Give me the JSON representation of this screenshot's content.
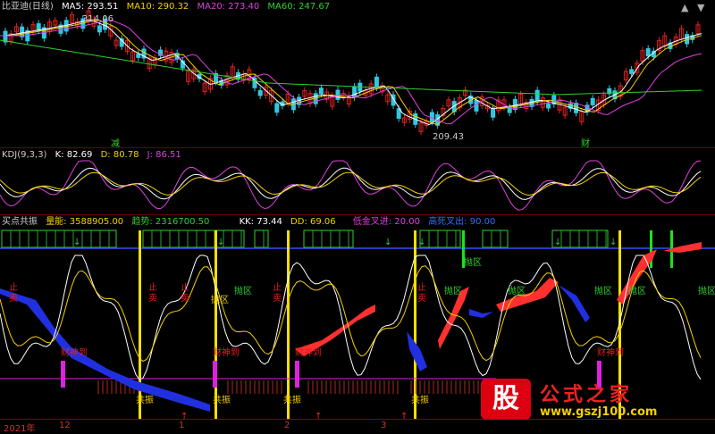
{
  "main": {
    "title": "比亚迪(日线)",
    "ma": [
      {
        "label": "MA5: 293.51",
        "color": "#ffffff"
      },
      {
        "label": "MA10: 290.32",
        "color": "#f5d000"
      },
      {
        "label": "MA20: 273.40",
        "color": "#e040e0"
      },
      {
        "label": "MA60: 247.67",
        "color": "#30d030"
      }
    ],
    "high_label": "314.06",
    "low_label": "209.43",
    "marker_left": "减",
    "marker_right": "财"
  },
  "kdj": {
    "title": "KDJ(9,3,3)",
    "items": [
      {
        "label": "K: 82.69",
        "color": "#ffffff"
      },
      {
        "label": "D: 80.78",
        "color": "#f5d000"
      },
      {
        "label": "J: 86.51",
        "color": "#e040e0"
      }
    ]
  },
  "signal": {
    "title": "买点共振",
    "items": [
      {
        "label": "量能: 3588905.00",
        "color": "#f5d000"
      },
      {
        "label": "趋势: 2316700.50",
        "color": "#30d030"
      },
      {
        "label": "KK: 73.44",
        "color": "#ffffff"
      },
      {
        "label": "DD: 69.06",
        "color": "#f5d000"
      },
      {
        "label": "低金叉进: 20.00",
        "color": "#e040e0"
      },
      {
        "label": "高死叉出: 90.00",
        "color": "#3070ff"
      }
    ],
    "labels_red": [
      "止",
      "卖",
      "止",
      "卖",
      "止",
      "卖",
      "止",
      "卖",
      "止",
      "卖"
    ],
    "labels_green": [
      "抛区",
      "抛区",
      "抛区",
      "抛区",
      "抛区",
      "抛区",
      "抛区",
      "抛区"
    ],
    "cai": [
      "财神到",
      "财神到",
      "财神到",
      "财神到"
    ],
    "gz": [
      "共振",
      "共振",
      "共振",
      "共振"
    ],
    "kou": "抄底"
  },
  "axis": {
    "labels": [
      "2021年",
      "12",
      "1",
      "2",
      "3"
    ]
  },
  "logo": {
    "mark": "股",
    "title": "公式之家",
    "url": "www.gszj100.com"
  },
  "controls": {
    "up": "▲",
    "down": "▼"
  }
}
